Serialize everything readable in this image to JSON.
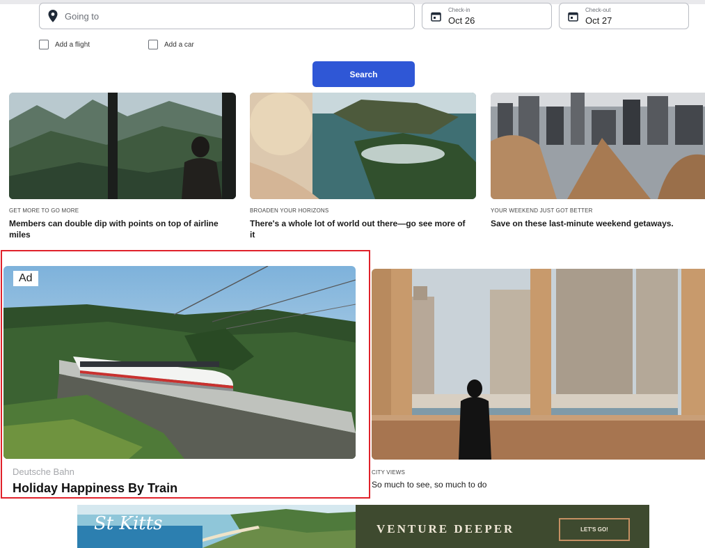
{
  "search": {
    "destination_placeholder": "Going to",
    "checkin_label": "Check-in",
    "checkin_value": "Oct 26",
    "checkout_label": "Check-out",
    "checkout_value": "Oct 27",
    "add_flight_label": "Add a flight",
    "add_car_label": "Add a car",
    "search_button_label": "Search"
  },
  "cards": [
    {
      "eyebrow": "GET MORE TO GO MORE",
      "headline": "Members can double dip with points on top of airline miles"
    },
    {
      "eyebrow": "BROADEN YOUR HORIZONS",
      "headline": "There's a whole lot of world out there—go see more of it"
    },
    {
      "eyebrow": "YOUR WEEKEND JUST GOT BETTER",
      "headline": "Save on these last-minute weekend getaways."
    }
  ],
  "ad_card": {
    "badge": "Ad",
    "advertiser": "Deutsche Bahn",
    "title": "Holiday Happiness By Train"
  },
  "city_card": {
    "eyebrow": "CITY VIEWS",
    "headline": "So much to see, so much to do"
  },
  "banner": {
    "brand": "St Kitts",
    "tagline": "VENTURE DEEPER",
    "cta": "LET'S GO!"
  },
  "colors": {
    "accent": "#2f57d6",
    "ad_highlight": "#e0212a"
  },
  "icons": {
    "destination": "map-pin-icon",
    "checkin": "calendar-icon",
    "checkout": "calendar-icon"
  }
}
